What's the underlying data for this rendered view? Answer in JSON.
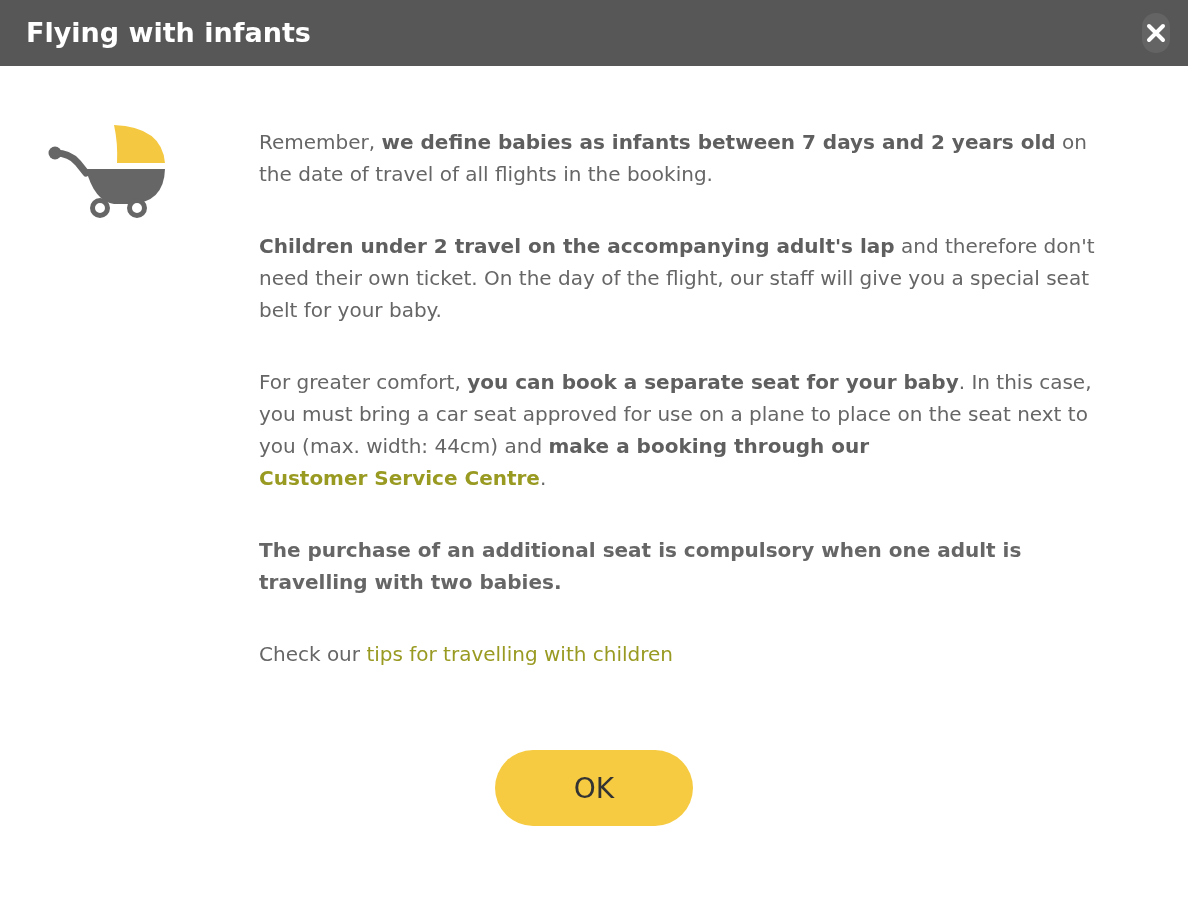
{
  "dialog": {
    "title": "Flying with infants"
  },
  "paragraphs": [
    {
      "bold": false,
      "segments": [
        {
          "kind": "text",
          "text": "Remember, **we define babies as infants between 7 days and 2 years old** on the date of travel of all flights in the booking."
        }
      ]
    },
    {
      "bold": false,
      "segments": [
        {
          "kind": "text",
          "text": "**Children under 2 travel on the accompanying adult's lap** and therefore don't need their own ticket. On the day of the flight, our staff will give you a special seat belt for your baby."
        }
      ]
    },
    {
      "bold": false,
      "segments": [
        {
          "kind": "text",
          "text": "For greater comfort, **you can book a separate seat for your baby**. In this case, you must bring a car seat approved for use on a plane to place on the seat next to you (max. width: 44cm) and **make a booking through our** "
        },
        {
          "kind": "link",
          "text": "Customer Service Centre",
          "bold": true
        },
        {
          "kind": "text",
          "text": "."
        }
      ]
    },
    {
      "bold": true,
      "segments": [
        {
          "kind": "text",
          "text": "The purchase of an additional seat is compulsory when one adult is travelling with two babies."
        }
      ]
    },
    {
      "bold": false,
      "segments": [
        {
          "kind": "text",
          "text": "Check our "
        },
        {
          "kind": "link",
          "text": "tips for travelling with children",
          "bold": false
        }
      ]
    }
  ],
  "button": {
    "label": "OK"
  }
}
